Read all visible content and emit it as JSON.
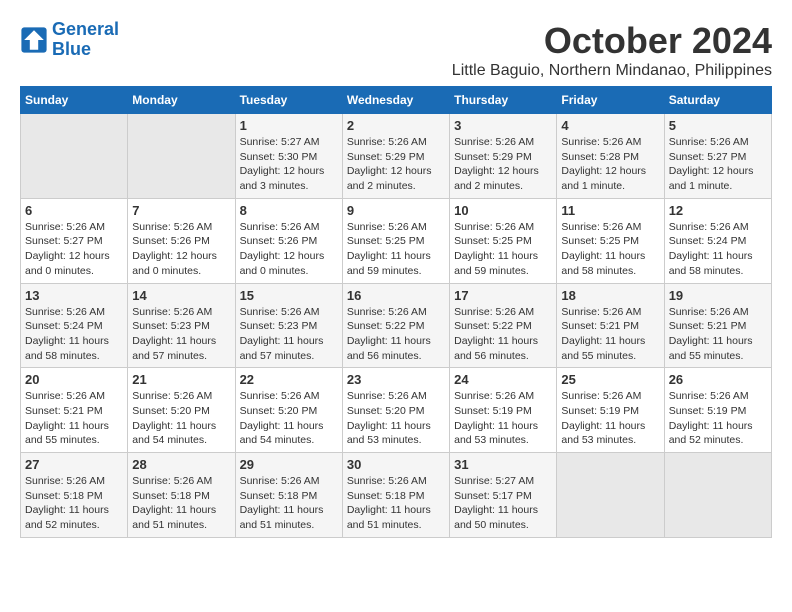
{
  "logo": {
    "line1": "General",
    "line2": "Blue"
  },
  "title": "October 2024",
  "location": "Little Baguio, Northern Mindanao, Philippines",
  "headers": [
    "Sunday",
    "Monday",
    "Tuesday",
    "Wednesday",
    "Thursday",
    "Friday",
    "Saturday"
  ],
  "weeks": [
    [
      {
        "day": "",
        "info": ""
      },
      {
        "day": "",
        "info": ""
      },
      {
        "day": "1",
        "info": "Sunrise: 5:27 AM\nSunset: 5:30 PM\nDaylight: 12 hours and 3 minutes."
      },
      {
        "day": "2",
        "info": "Sunrise: 5:26 AM\nSunset: 5:29 PM\nDaylight: 12 hours and 2 minutes."
      },
      {
        "day": "3",
        "info": "Sunrise: 5:26 AM\nSunset: 5:29 PM\nDaylight: 12 hours and 2 minutes."
      },
      {
        "day": "4",
        "info": "Sunrise: 5:26 AM\nSunset: 5:28 PM\nDaylight: 12 hours and 1 minute."
      },
      {
        "day": "5",
        "info": "Sunrise: 5:26 AM\nSunset: 5:27 PM\nDaylight: 12 hours and 1 minute."
      }
    ],
    [
      {
        "day": "6",
        "info": "Sunrise: 5:26 AM\nSunset: 5:27 PM\nDaylight: 12 hours and 0 minutes."
      },
      {
        "day": "7",
        "info": "Sunrise: 5:26 AM\nSunset: 5:26 PM\nDaylight: 12 hours and 0 minutes."
      },
      {
        "day": "8",
        "info": "Sunrise: 5:26 AM\nSunset: 5:26 PM\nDaylight: 12 hours and 0 minutes."
      },
      {
        "day": "9",
        "info": "Sunrise: 5:26 AM\nSunset: 5:25 PM\nDaylight: 11 hours and 59 minutes."
      },
      {
        "day": "10",
        "info": "Sunrise: 5:26 AM\nSunset: 5:25 PM\nDaylight: 11 hours and 59 minutes."
      },
      {
        "day": "11",
        "info": "Sunrise: 5:26 AM\nSunset: 5:25 PM\nDaylight: 11 hours and 58 minutes."
      },
      {
        "day": "12",
        "info": "Sunrise: 5:26 AM\nSunset: 5:24 PM\nDaylight: 11 hours and 58 minutes."
      }
    ],
    [
      {
        "day": "13",
        "info": "Sunrise: 5:26 AM\nSunset: 5:24 PM\nDaylight: 11 hours and 58 minutes."
      },
      {
        "day": "14",
        "info": "Sunrise: 5:26 AM\nSunset: 5:23 PM\nDaylight: 11 hours and 57 minutes."
      },
      {
        "day": "15",
        "info": "Sunrise: 5:26 AM\nSunset: 5:23 PM\nDaylight: 11 hours and 57 minutes."
      },
      {
        "day": "16",
        "info": "Sunrise: 5:26 AM\nSunset: 5:22 PM\nDaylight: 11 hours and 56 minutes."
      },
      {
        "day": "17",
        "info": "Sunrise: 5:26 AM\nSunset: 5:22 PM\nDaylight: 11 hours and 56 minutes."
      },
      {
        "day": "18",
        "info": "Sunrise: 5:26 AM\nSunset: 5:21 PM\nDaylight: 11 hours and 55 minutes."
      },
      {
        "day": "19",
        "info": "Sunrise: 5:26 AM\nSunset: 5:21 PM\nDaylight: 11 hours and 55 minutes."
      }
    ],
    [
      {
        "day": "20",
        "info": "Sunrise: 5:26 AM\nSunset: 5:21 PM\nDaylight: 11 hours and 55 minutes."
      },
      {
        "day": "21",
        "info": "Sunrise: 5:26 AM\nSunset: 5:20 PM\nDaylight: 11 hours and 54 minutes."
      },
      {
        "day": "22",
        "info": "Sunrise: 5:26 AM\nSunset: 5:20 PM\nDaylight: 11 hours and 54 minutes."
      },
      {
        "day": "23",
        "info": "Sunrise: 5:26 AM\nSunset: 5:20 PM\nDaylight: 11 hours and 53 minutes."
      },
      {
        "day": "24",
        "info": "Sunrise: 5:26 AM\nSunset: 5:19 PM\nDaylight: 11 hours and 53 minutes."
      },
      {
        "day": "25",
        "info": "Sunrise: 5:26 AM\nSunset: 5:19 PM\nDaylight: 11 hours and 53 minutes."
      },
      {
        "day": "26",
        "info": "Sunrise: 5:26 AM\nSunset: 5:19 PM\nDaylight: 11 hours and 52 minutes."
      }
    ],
    [
      {
        "day": "27",
        "info": "Sunrise: 5:26 AM\nSunset: 5:18 PM\nDaylight: 11 hours and 52 minutes."
      },
      {
        "day": "28",
        "info": "Sunrise: 5:26 AM\nSunset: 5:18 PM\nDaylight: 11 hours and 51 minutes."
      },
      {
        "day": "29",
        "info": "Sunrise: 5:26 AM\nSunset: 5:18 PM\nDaylight: 11 hours and 51 minutes."
      },
      {
        "day": "30",
        "info": "Sunrise: 5:26 AM\nSunset: 5:18 PM\nDaylight: 11 hours and 51 minutes."
      },
      {
        "day": "31",
        "info": "Sunrise: 5:27 AM\nSunset: 5:17 PM\nDaylight: 11 hours and 50 minutes."
      },
      {
        "day": "",
        "info": ""
      },
      {
        "day": "",
        "info": ""
      }
    ]
  ]
}
